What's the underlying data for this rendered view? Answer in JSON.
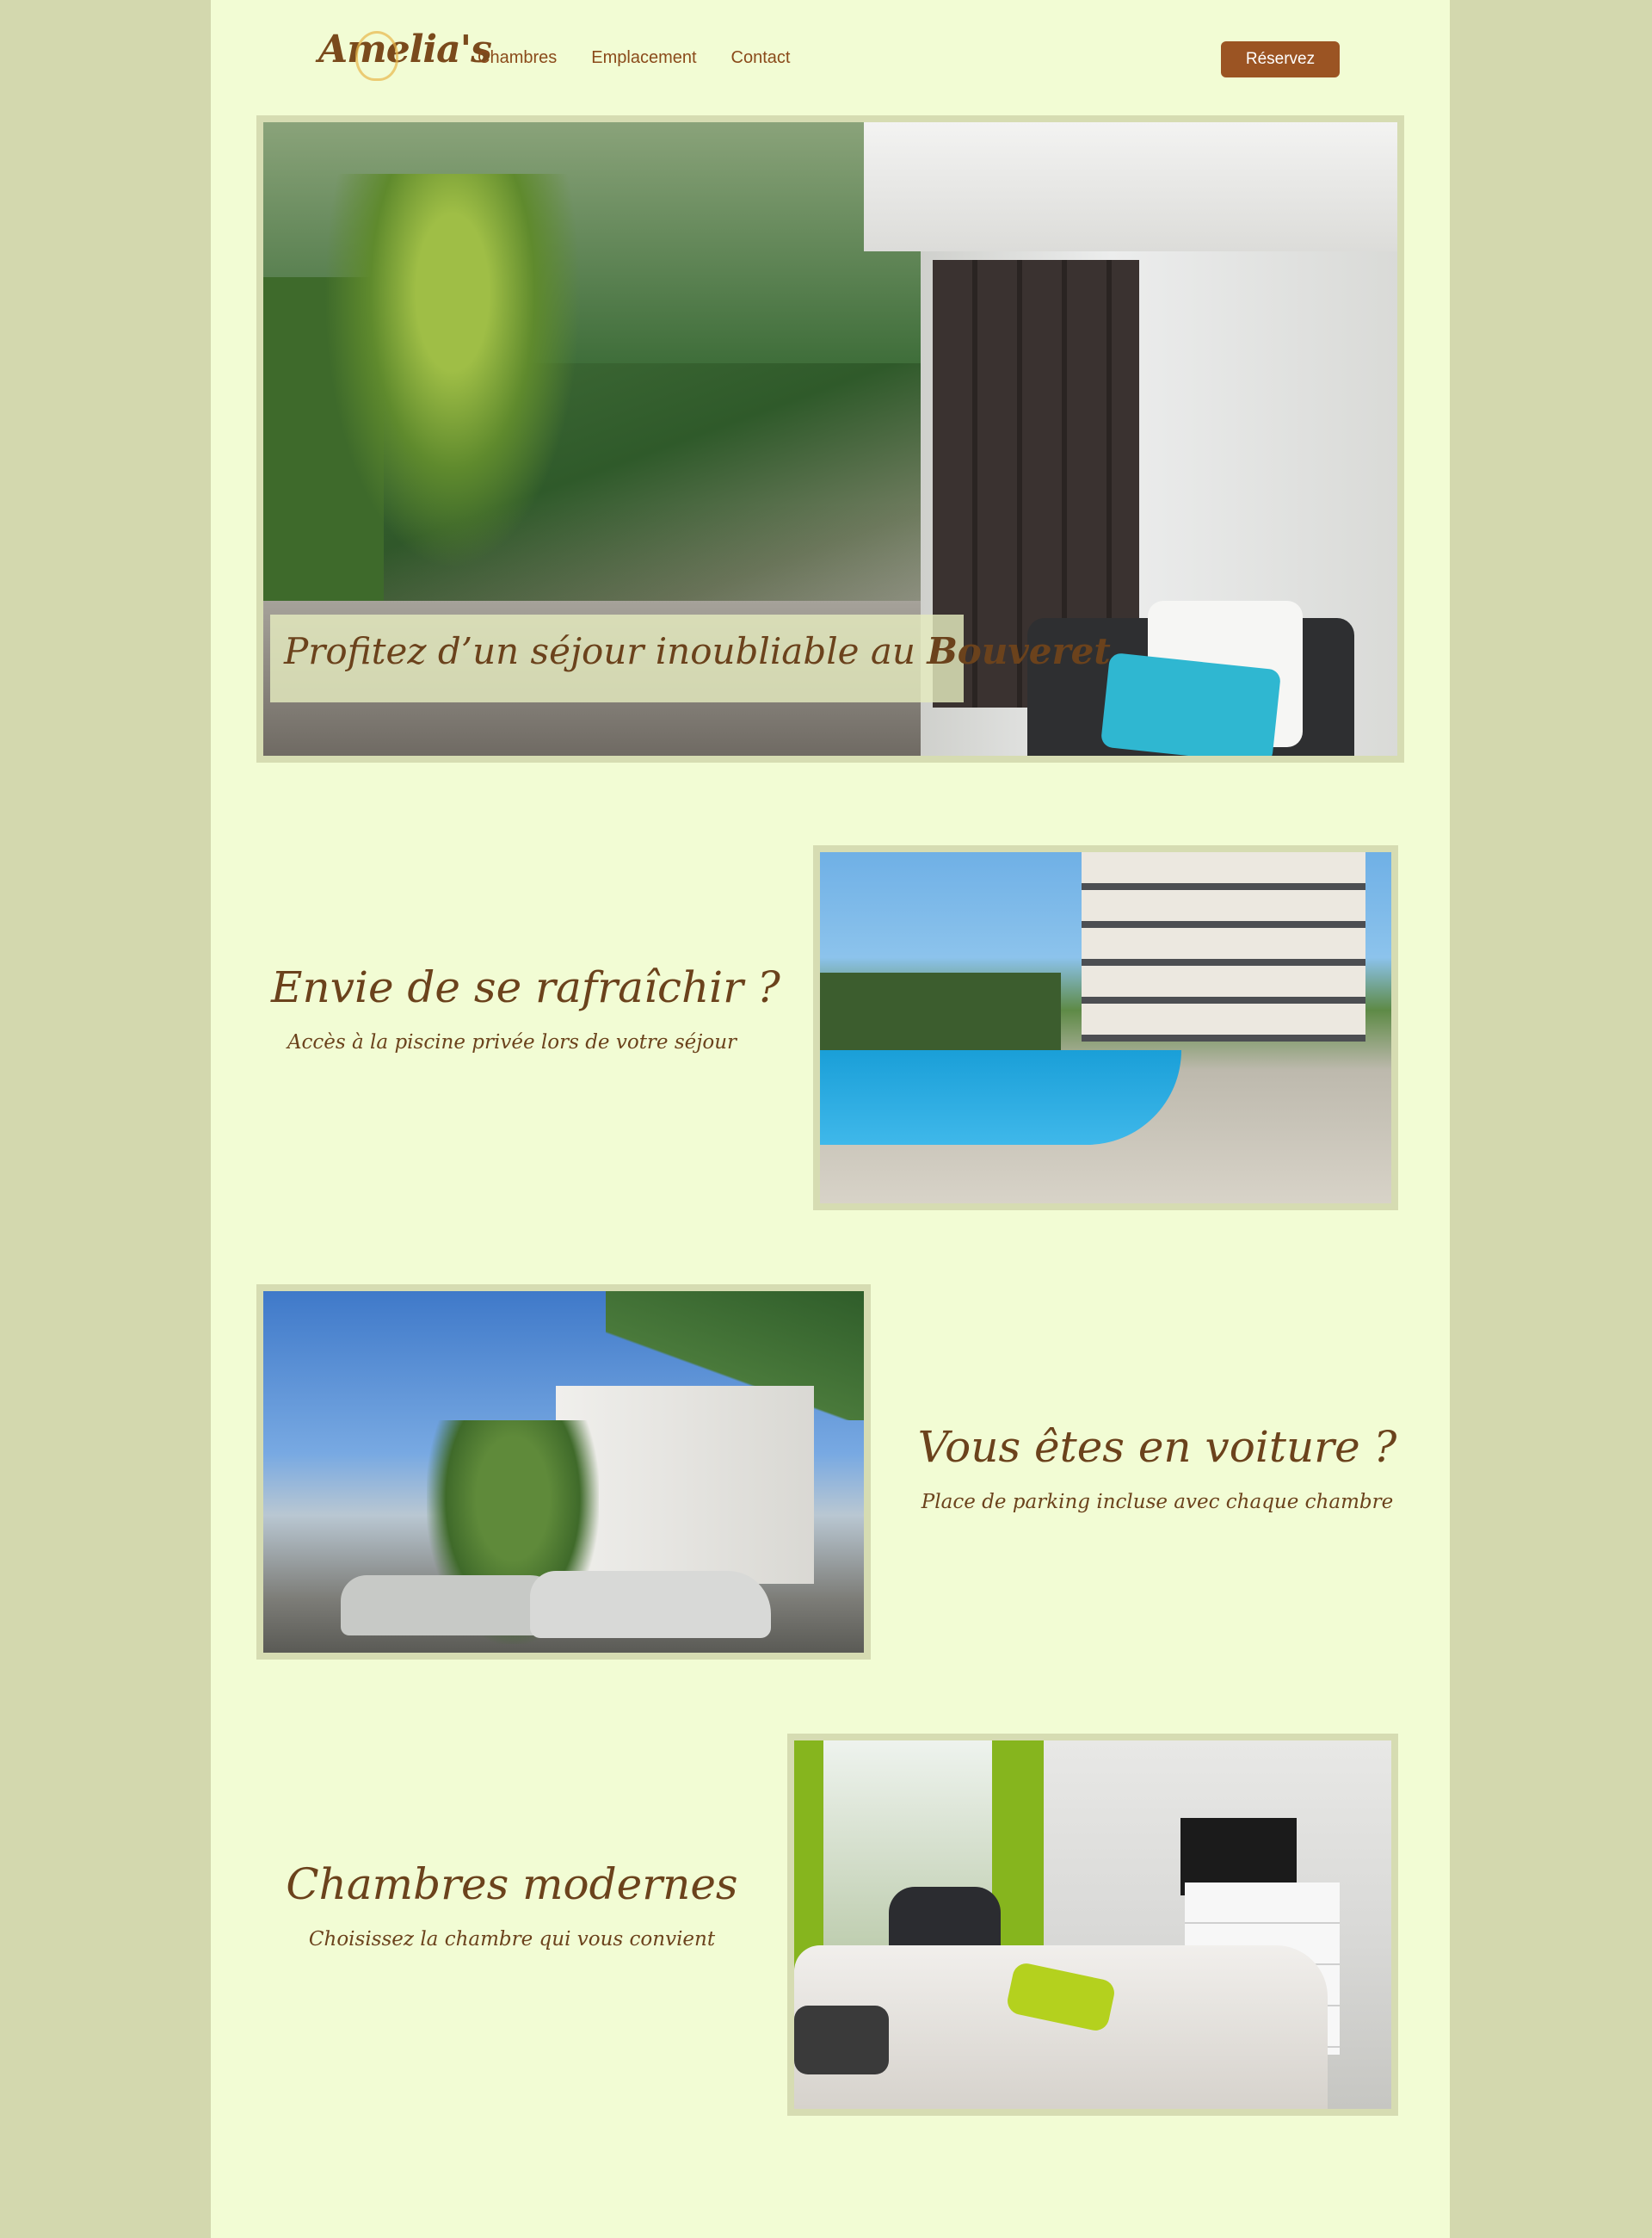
{
  "header": {
    "logo_text": "Amelia's",
    "nav": [
      "Chambres",
      "Emplacement",
      "Contact"
    ],
    "reserve_label": "Réservez"
  },
  "hero": {
    "caption_prefix": "Profitez d’un séjour inoubliable au ",
    "caption_bold": "Bouveret"
  },
  "features": [
    {
      "title": "Envie de se rafraîchir ?",
      "subtitle": "Accès à la piscine privée lors de votre séjour"
    },
    {
      "title": "Vous êtes en voiture ?",
      "subtitle": "Place de parking incluse avec chaque chambre"
    },
    {
      "title": "Chambres modernes",
      "subtitle": "Choisissez la chambre qui vous convient"
    }
  ],
  "colors": {
    "outer_background": "#d3d8ae",
    "page_background": "#f2fcd4",
    "text_brown": "#6b421c",
    "button_brown": "#9b5423",
    "photo_frame": "#d6dcb2"
  }
}
